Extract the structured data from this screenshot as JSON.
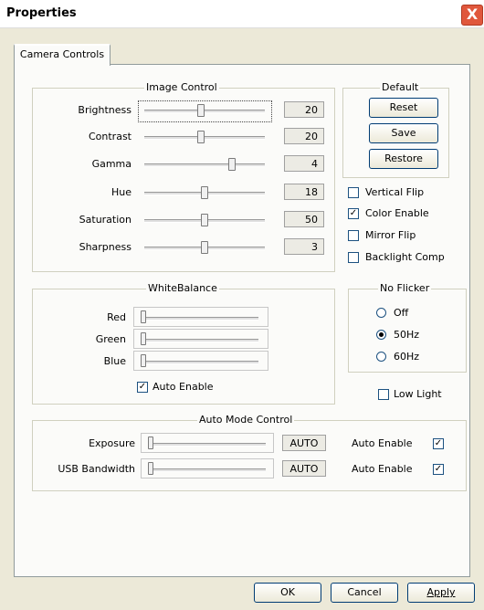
{
  "window": {
    "title": "Properties",
    "close_glyph": "X"
  },
  "tabs": [
    {
      "label": "Camera Controls"
    }
  ],
  "image_control": {
    "title": "Image Control",
    "rows": [
      {
        "label": "Brightness",
        "value": "20",
        "level": 0.46
      },
      {
        "label": "Contrast",
        "value": "20",
        "level": 0.46
      },
      {
        "label": "Gamma",
        "value": "4",
        "level": 0.72
      },
      {
        "label": "Hue",
        "value": "18",
        "level": 0.49
      },
      {
        "label": "Saturation",
        "value": "50",
        "level": 0.49
      },
      {
        "label": "Sharpness",
        "value": "3",
        "level": 0.49
      }
    ]
  },
  "default_group": {
    "title": "Default",
    "reset": "Reset",
    "save": "Save",
    "restore": "Restore"
  },
  "options": [
    {
      "label": "Vertical Flip",
      "checked": false
    },
    {
      "label": "Color Enable",
      "checked": true
    },
    {
      "label": "Mirror Flip",
      "checked": false
    },
    {
      "label": "Backlight Comp",
      "checked": false
    }
  ],
  "white_balance": {
    "title": "WhiteBalance",
    "rows": [
      {
        "label": "Red"
      },
      {
        "label": "Green"
      },
      {
        "label": "Blue"
      }
    ],
    "auto_enable": {
      "label": "Auto Enable",
      "checked": true
    }
  },
  "no_flicker": {
    "title": "No Flicker",
    "options": [
      {
        "label": "Off"
      },
      {
        "label": "50Hz"
      },
      {
        "label": "60Hz"
      }
    ],
    "selected": "50Hz"
  },
  "low_light": {
    "label": "Low Light",
    "checked": false
  },
  "auto_mode": {
    "title": "Auto Mode Control",
    "rows": [
      {
        "label": "Exposure",
        "value": "AUTO",
        "auto_label": "Auto Enable",
        "checked": true
      },
      {
        "label": "USB Bandwidth",
        "value": "AUTO",
        "auto_label": "Auto Enable",
        "checked": true
      }
    ]
  },
  "footer": {
    "ok": "OK",
    "cancel": "Cancel",
    "apply": "Apply"
  },
  "glyphs": {
    "check": "✓"
  }
}
